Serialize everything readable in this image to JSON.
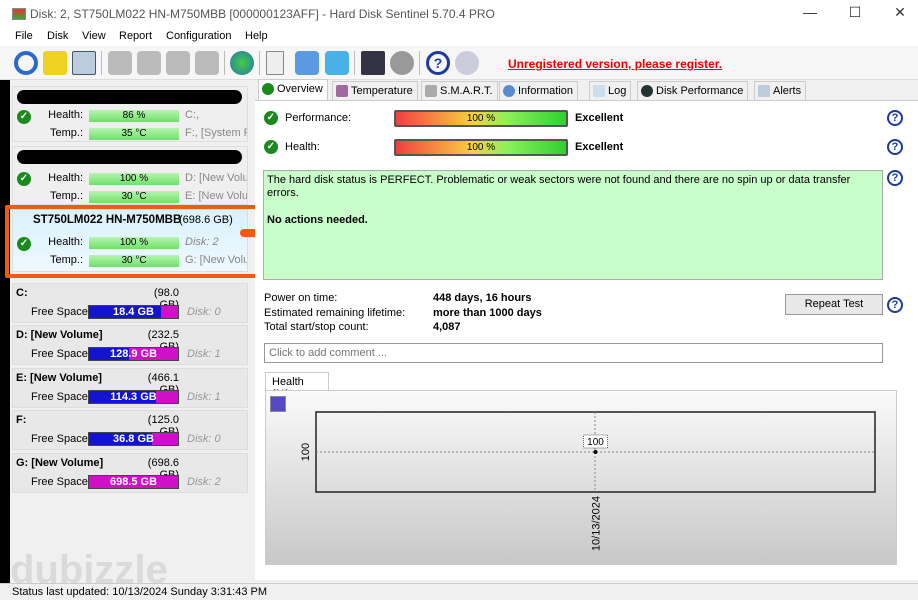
{
  "window": {
    "title": "Disk: 2, ST750LM022 HN-M750MBB [000000123AFF]  -  Hard Disk Sentinel 5.70.4 PRO",
    "minimize": "—",
    "maximize": "☐",
    "close": "✕"
  },
  "menu": [
    "File",
    "Disk",
    "View",
    "Report",
    "Configuration",
    "Help"
  ],
  "toolbar": {
    "icons": [
      "refresh-icon",
      "alert-icon",
      "disk-icon",
      "disk-test-icon",
      "disk-timer-icon",
      "disk-ok-icon",
      "disk-search-icon",
      "globe-disk-icon",
      "report-icon",
      "sync-icon",
      "network-icon",
      "monitor-icon",
      "speaker-icon",
      "help-icon"
    ],
    "unregistered": "Unregistered version, please register."
  },
  "disks": [
    {
      "name": "",
      "health": "86 %",
      "temp": "35 °C",
      "info1": "C:,",
      "info2": "F:,  [System R"
    },
    {
      "name": "",
      "health": "100 %",
      "temp": "30 °C",
      "info1": "D: [New Volu",
      "info2": "E: [New Volur"
    },
    {
      "name": "ST750LM022 HN-M750MBB",
      "size": "(698.6 GB)",
      "health": "100 %",
      "temp": "30 °C",
      "info1": "Disk: 2",
      "info2": "G: [New Volu"
    }
  ],
  "labels": {
    "health": "Health:",
    "temp": "Temp.:",
    "free_space": "Free Space"
  },
  "volumes": [
    {
      "name": "C:",
      "size": "(98.0 GB)",
      "free": "18.4 GB",
      "used_fraction": 0.81,
      "disk": "Disk: 0"
    },
    {
      "name": "D: [New Volume]",
      "size": "(232.5 GB)",
      "free": "128.9 GB",
      "used_fraction": 0.45,
      "disk": "Disk: 1"
    },
    {
      "name": "E: [New Volume]",
      "size": "(466.1 GB)",
      "free": "114.3 GB",
      "used_fraction": 0.75,
      "disk": "Disk: 1"
    },
    {
      "name": "F:",
      "size": "(125.0 GB)",
      "free": "36.8 GB",
      "used_fraction": 0.71,
      "disk": "Disk: 0"
    },
    {
      "name": "G: [New Volume]",
      "size": "(698.6 GB)",
      "free": "698.5 GB",
      "used_fraction": 0.0,
      "disk": "Disk: 2"
    }
  ],
  "tabs": [
    "Overview",
    "Temperature",
    "S.M.A.R.T.",
    "Information",
    "Log",
    "Disk Performance",
    "Alerts"
  ],
  "overview": {
    "performance_label": "Performance:",
    "performance_value": "100 %",
    "performance_rating": "Excellent",
    "health_label": "Health:",
    "health_value": "100 %",
    "health_rating": "Excellent",
    "status_text": "The hard disk status is PERFECT. Problematic or weak sectors were not found and there are no spin up or data transfer errors.",
    "action_text": "No actions needed.",
    "power_on_label": "Power on time:",
    "power_on_value": "448 days, 16 hours",
    "lifetime_label": "Estimated remaining lifetime:",
    "lifetime_value": "more than 1000 days",
    "startstop_label": "Total start/stop count:",
    "startstop_value": "4,087",
    "repeat_test": "Repeat Test",
    "comment_placeholder": "Click to add comment ...",
    "help": "?"
  },
  "chart_data": {
    "type": "line",
    "tab_label": "Health (%)",
    "x": [
      "10/13/2024"
    ],
    "values": [
      100
    ],
    "data_labels": [
      "100"
    ],
    "ytick": "100",
    "grid": true
  },
  "status_bar": "Status last updated: 10/13/2024 Sunday 3:31:43 PM",
  "watermark": "dubizzle",
  "colors": {
    "annotation": "#f05a14",
    "free_space": "#1414d0",
    "used_space": "#d010c8",
    "status_ok": "#c8fcc8",
    "unregistered": "#e00000"
  }
}
